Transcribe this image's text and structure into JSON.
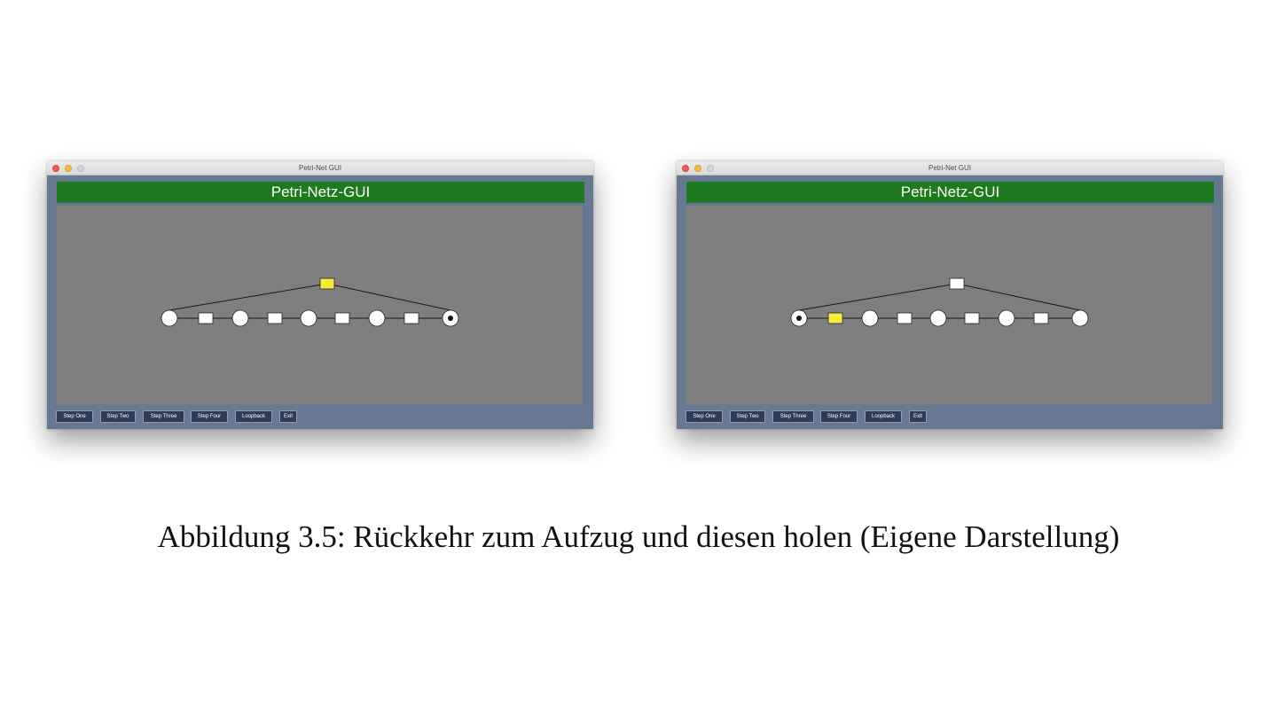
{
  "windows": [
    {
      "window_title": "Petri-Net GUI",
      "header": "Petri-Netz-GUI",
      "buttons": [
        "Step One",
        "Step Two",
        "Step Three",
        "Step Four",
        "Loopback",
        "Exit"
      ],
      "net": {
        "highlighted_transition": "top",
        "token_place": "place-5",
        "colors": {
          "highlight": "#f7ea3a",
          "node": "#ffffff",
          "canvas": "#7f7f7f",
          "header": "#1e7a1e"
        }
      }
    },
    {
      "window_title": "Petri-Net GUI",
      "header": "Petri-Netz-GUI",
      "buttons": [
        "Step One",
        "Step Two",
        "Step Three",
        "Step Four",
        "Loopback",
        "Exit"
      ],
      "net": {
        "highlighted_transition": "transition-1",
        "token_place": "place-1",
        "colors": {
          "highlight": "#f7ea3a",
          "node": "#ffffff",
          "canvas": "#7f7f7f",
          "header": "#1e7a1e"
        }
      }
    }
  ],
  "caption": "Abbildung 3.5: Rückkehr zum Aufzug und diesen holen (Eigene Darstellung)"
}
